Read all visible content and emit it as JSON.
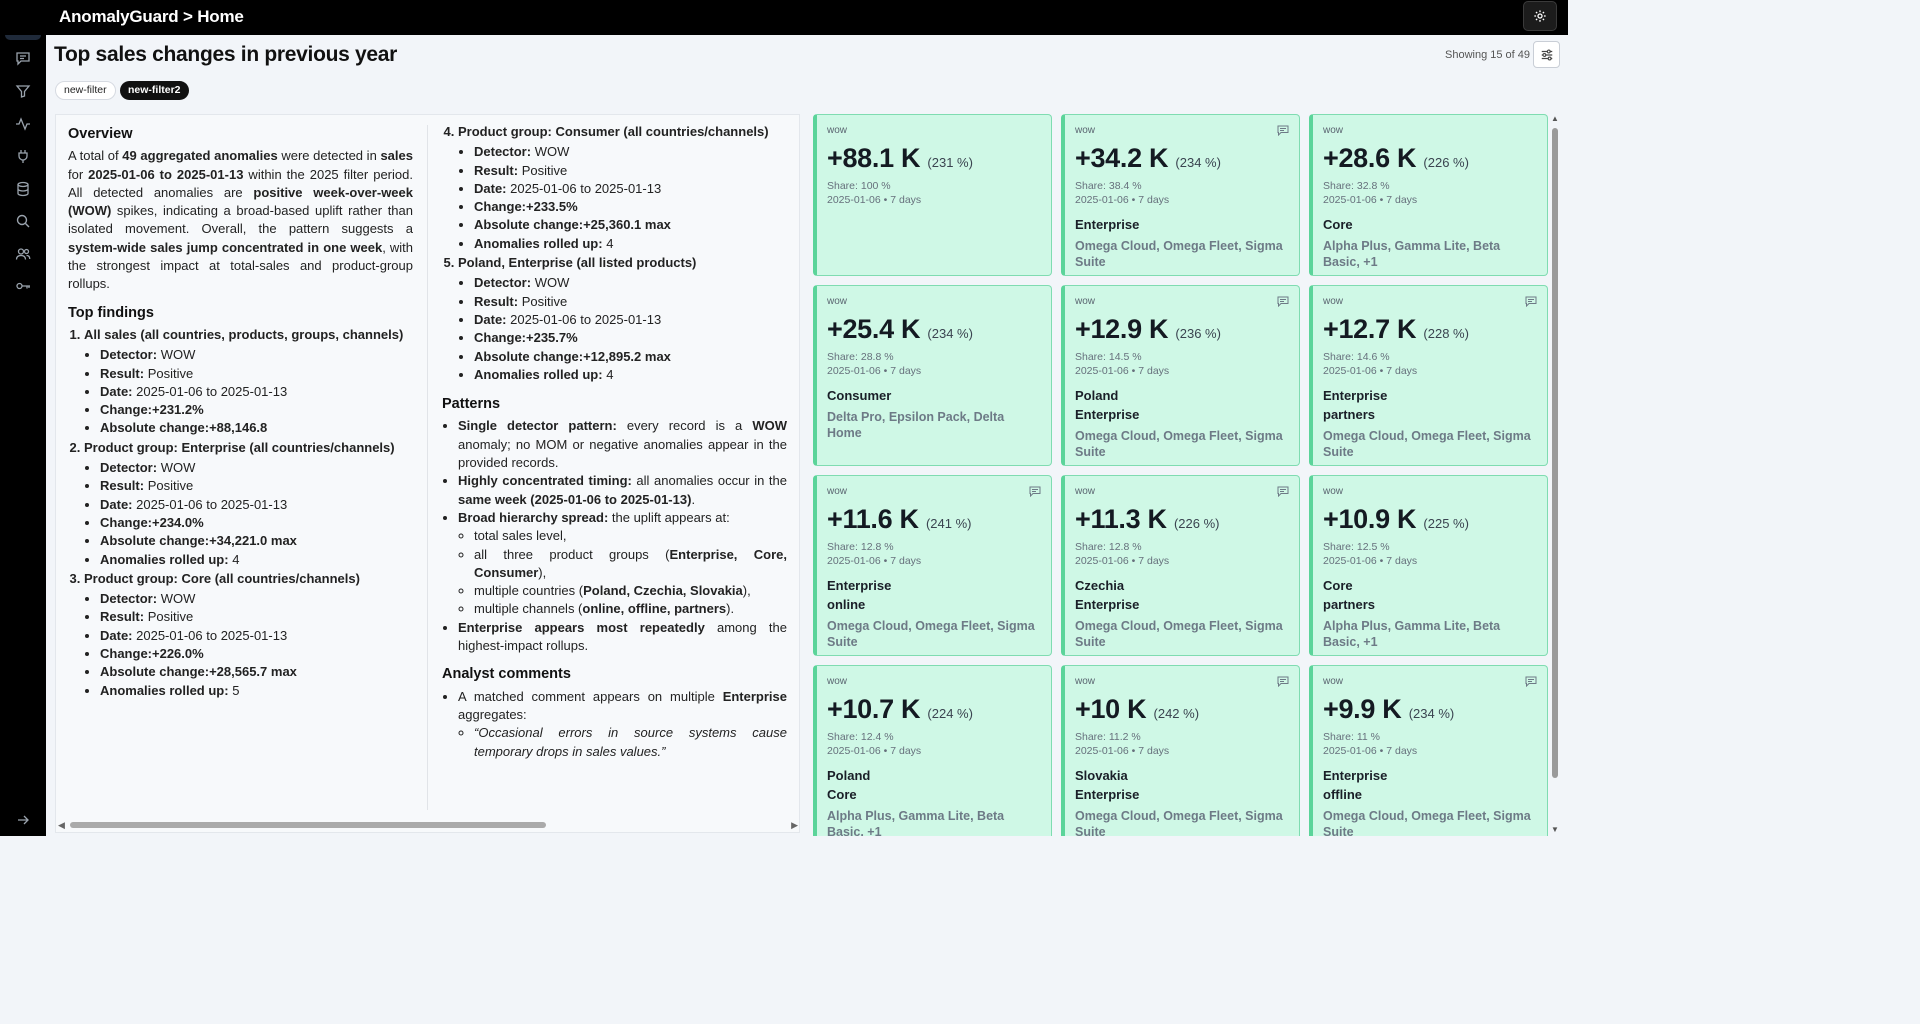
{
  "app": {
    "breadcrumb": "AnomalyGuard > Home"
  },
  "header": {
    "title": "Top sales changes in previous year",
    "showing": "Showing 15 of 49"
  },
  "filters": [
    "new-filter",
    "new-filter2"
  ],
  "rail": [
    "home-icon",
    "chat-icon",
    "filter-icon",
    "activity-icon",
    "plug-icon",
    "database-icon",
    "search-icon",
    "users-icon",
    "key-icon",
    "expand-icon"
  ],
  "overview": {
    "title": "Overview",
    "t1": "A total of ",
    "b1": "49 aggregated anomalies",
    "t2": " were detected in ",
    "b2": "sales",
    "t3": " for ",
    "b3": "2025-01-06 to 2025-01-13",
    "t4": " within the 2025 filter period. All detected anomalies are ",
    "b4": "positive week-over-week (WOW)",
    "t5": " spikes, indicating a broad-based uplift rather than isolated movement. Overall, the pattern suggests a ",
    "b5": "system-wide sales jump concentrated in one week",
    "t6": ", with the strongest impact at total-sales and product-group rollups."
  },
  "labels": {
    "detector": "Detector:",
    "result": "Result:",
    "date": "Date:",
    "change": "Change:",
    "abs": "Absolute change:",
    "rolled": "Anomalies rolled up:"
  },
  "top_findings": {
    "title": "Top findings",
    "items": [
      {
        "title": "All sales (all countries, products, groups, channels)",
        "detector": "WOW",
        "result": "Positive",
        "date": "2025-01-06 to 2025-01-13",
        "change": "+231.2%",
        "abs": "+88,146.8",
        "rolled": ""
      },
      {
        "title": "Product group: Enterprise (all countries/channels)",
        "detector": "WOW",
        "result": "Positive",
        "date": "2025-01-06 to 2025-01-13",
        "change": "+234.0%",
        "abs": "+34,221.0 max",
        "rolled": "4"
      },
      {
        "title": "Product group: Core (all countries/channels)",
        "detector": "WOW",
        "result": "Positive",
        "date": "2025-01-06 to 2025-01-13",
        "change": "+226.0%",
        "abs": "+28,565.7 max",
        "rolled": "5"
      },
      {
        "title": "Product group: Consumer (all countries/channels)",
        "detector": "WOW",
        "result": "Positive",
        "date": "2025-01-06 to 2025-01-13",
        "change": "+233.5%",
        "abs": "+25,360.1 max",
        "rolled": "4"
      },
      {
        "title": "Poland, Enterprise (all listed products)",
        "detector": "WOW",
        "result": "Positive",
        "date": "2025-01-06 to 2025-01-13",
        "change": "+235.7%",
        "abs": "+12,895.2 max",
        "rolled": "4"
      }
    ]
  },
  "patterns": {
    "title": "Patterns",
    "p1b": "Single detector pattern:",
    "p1a": " every record is a ",
    "p1c": "WOW",
    "p1d": " anomaly; no MOM or negative anomalies appear in the provided records.",
    "p2b": "Highly concentrated timing:",
    "p2a": " all anomalies occur in the ",
    "p2c": "same week (2025-01-06 to 2025-01-13)",
    "p2d": ".",
    "p3b": "Broad hierarchy spread:",
    "p3a": " the uplift appears at:",
    "s1": "total sales level,",
    "s2a": "all three product groups (",
    "s2b": "Enterprise, Core, Consumer",
    "s2c": "),",
    "s3a": "multiple countries (",
    "s3b": "Poland, Czechia, Slovakia",
    "s3c": "),",
    "s4a": "multiple channels (",
    "s4b": "online, offline, partners",
    "s4c": ").",
    "p4b": "Enterprise appears most repeatedly",
    "p4a": " among the highest-impact rollups."
  },
  "analyst": {
    "title": "Analyst comments",
    "t1": "A matched comment appears on multiple ",
    "b1": "Enterprise",
    "t2": " aggregates:",
    "quote": "“Occasional errors in source systems cause temporary drops in sales values.”"
  },
  "cards": [
    {
      "det": "wow",
      "val": "+88.1 K",
      "pct": "(231 %)",
      "share": "Share: 100 %",
      "when": "2025-01-06 • 7 days",
      "l1": "",
      "l2": "",
      "prods": "",
      "cmt": false
    },
    {
      "det": "wow",
      "val": "+34.2 K",
      "pct": "(234 %)",
      "share": "Share: 38.4 %",
      "when": "2025-01-06 • 7 days",
      "l1": "Enterprise",
      "l2": "",
      "prods": "Omega Cloud, Omega Fleet, Sigma Suite",
      "cmt": true
    },
    {
      "det": "wow",
      "val": "+28.6 K",
      "pct": "(226 %)",
      "share": "Share: 32.8 %",
      "when": "2025-01-06 • 7 days",
      "l1": "Core",
      "l2": "",
      "prods": "Alpha Plus, Gamma Lite, Beta Basic, +1",
      "cmt": false
    },
    {
      "det": "wow",
      "val": "+25.4 K",
      "pct": "(234 %)",
      "share": "Share: 28.8 %",
      "when": "2025-01-06 • 7 days",
      "l1": "Consumer",
      "l2": "",
      "prods": "Delta Pro, Epsilon Pack, Delta Home",
      "cmt": false
    },
    {
      "det": "wow",
      "val": "+12.9 K",
      "pct": "(236 %)",
      "share": "Share: 14.5 %",
      "when": "2025-01-06 • 7 days",
      "l1": "Poland",
      "l2": "Enterprise",
      "prods": "Omega Cloud, Omega Fleet, Sigma Suite",
      "cmt": true
    },
    {
      "det": "wow",
      "val": "+12.7 K",
      "pct": "(228 %)",
      "share": "Share: 14.6 %",
      "when": "2025-01-06 • 7 days",
      "l1": "Enterprise",
      "l2": "partners",
      "prods": "Omega Cloud, Omega Fleet, Sigma Suite",
      "cmt": true
    },
    {
      "det": "wow",
      "val": "+11.6 K",
      "pct": "(241 %)",
      "share": "Share: 12.8 %",
      "when": "2025-01-06 • 7 days",
      "l1": "Enterprise",
      "l2": "online",
      "prods": "Omega Cloud, Omega Fleet, Sigma Suite",
      "cmt": true
    },
    {
      "det": "wow",
      "val": "+11.3 K",
      "pct": "(226 %)",
      "share": "Share: 12.8 %",
      "when": "2025-01-06 • 7 days",
      "l1": "Czechia",
      "l2": "Enterprise",
      "prods": "Omega Cloud, Omega Fleet, Sigma Suite",
      "cmt": true
    },
    {
      "det": "wow",
      "val": "+10.9 K",
      "pct": "(225 %)",
      "share": "Share: 12.5 %",
      "when": "2025-01-06 • 7 days",
      "l1": "Core",
      "l2": "partners",
      "prods": "Alpha Plus, Gamma Lite, Beta Basic, +1",
      "cmt": false
    },
    {
      "det": "wow",
      "val": "+10.7 K",
      "pct": "(224 %)",
      "share": "Share: 12.4 %",
      "when": "2025-01-06 • 7 days",
      "l1": "Poland",
      "l2": "Core",
      "prods": "Alpha Plus, Gamma Lite, Beta Basic, +1",
      "cmt": false
    },
    {
      "det": "wow",
      "val": "+10 K",
      "pct": "(242 %)",
      "share": "Share: 11.2 %",
      "when": "2025-01-06 • 7 days",
      "l1": "Slovakia",
      "l2": "Enterprise",
      "prods": "Omega Cloud, Omega Fleet, Sigma Suite",
      "cmt": true
    },
    {
      "det": "wow",
      "val": "+9.9 K",
      "pct": "(234 %)",
      "share": "Share: 11 %",
      "when": "2025-01-06 • 7 days",
      "l1": "Enterprise",
      "l2": "offline",
      "prods": "Omega Cloud, Omega Fleet, Sigma Suite",
      "cmt": true
    }
  ],
  "colors": {
    "card_bg": "#cff8e6",
    "card_border": "#5bd49a",
    "topbar": "#000000"
  }
}
